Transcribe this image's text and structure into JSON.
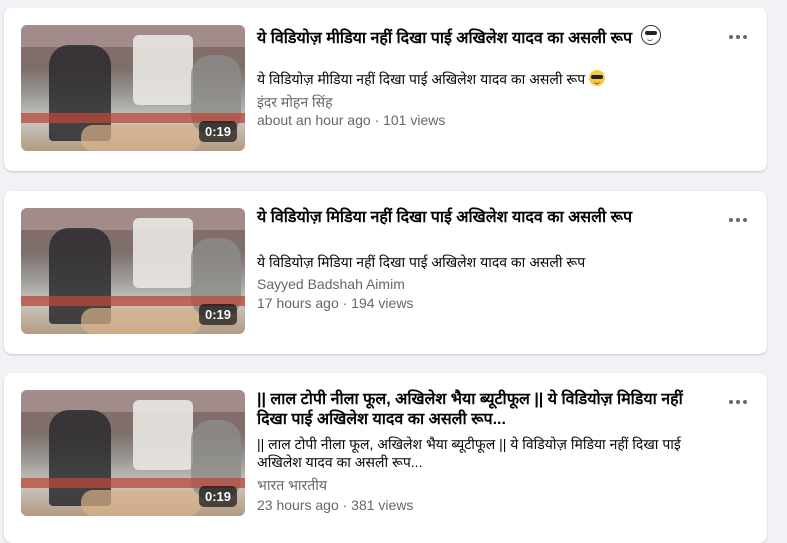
{
  "videos": [
    {
      "duration": "0:19",
      "title": "ये विडियोज़ मीडिया नहीं दिखा पाई अखिलेश यादव का असली रूप",
      "title_emoji": "sunglasses-emoji",
      "description": "ये विडियोज़ मीडिया नहीं दिखा पाई अखिलेश यादव का असली रूप",
      "description_emoji": "sunglasses-emoji",
      "author": "इंदर मोहन सिंह",
      "meta": "about an hour ago · 101 views"
    },
    {
      "duration": "0:19",
      "title": "ये विडियोज़ मिडिया नहीं दिखा पाई अखिलेश यादव का असली रूप",
      "description": "ये विडियोज़ मिडिया नहीं दिखा पाई अखिलेश यादव का असली रूप",
      "author": "Sayyed Badshah Aimim",
      "meta": "17 hours ago · 194 views"
    },
    {
      "duration": "0:19",
      "title": "|| लाल टोपी नीला फूल, अखिलेश भैया ब्यूटीफूल || ये विडियोज़ मिडिया नहीं दिखा पाई अखिलेश यादव का असली रूप...",
      "description": "|| लाल टोपी नीला फूल, अखिलेश भैया ब्यूटीफूल || ये विडियोज़ मिडिया नहीं दिखा पाई अखिलेश यादव का असली रूप...",
      "author": "भारत भारतीय",
      "meta": "23 hours ago · 381 views"
    }
  ],
  "more_icon": "more-options-icon",
  "colors": {
    "background": "#f0f2f5",
    "card": "#ffffff",
    "secondary_text": "#65676b"
  }
}
